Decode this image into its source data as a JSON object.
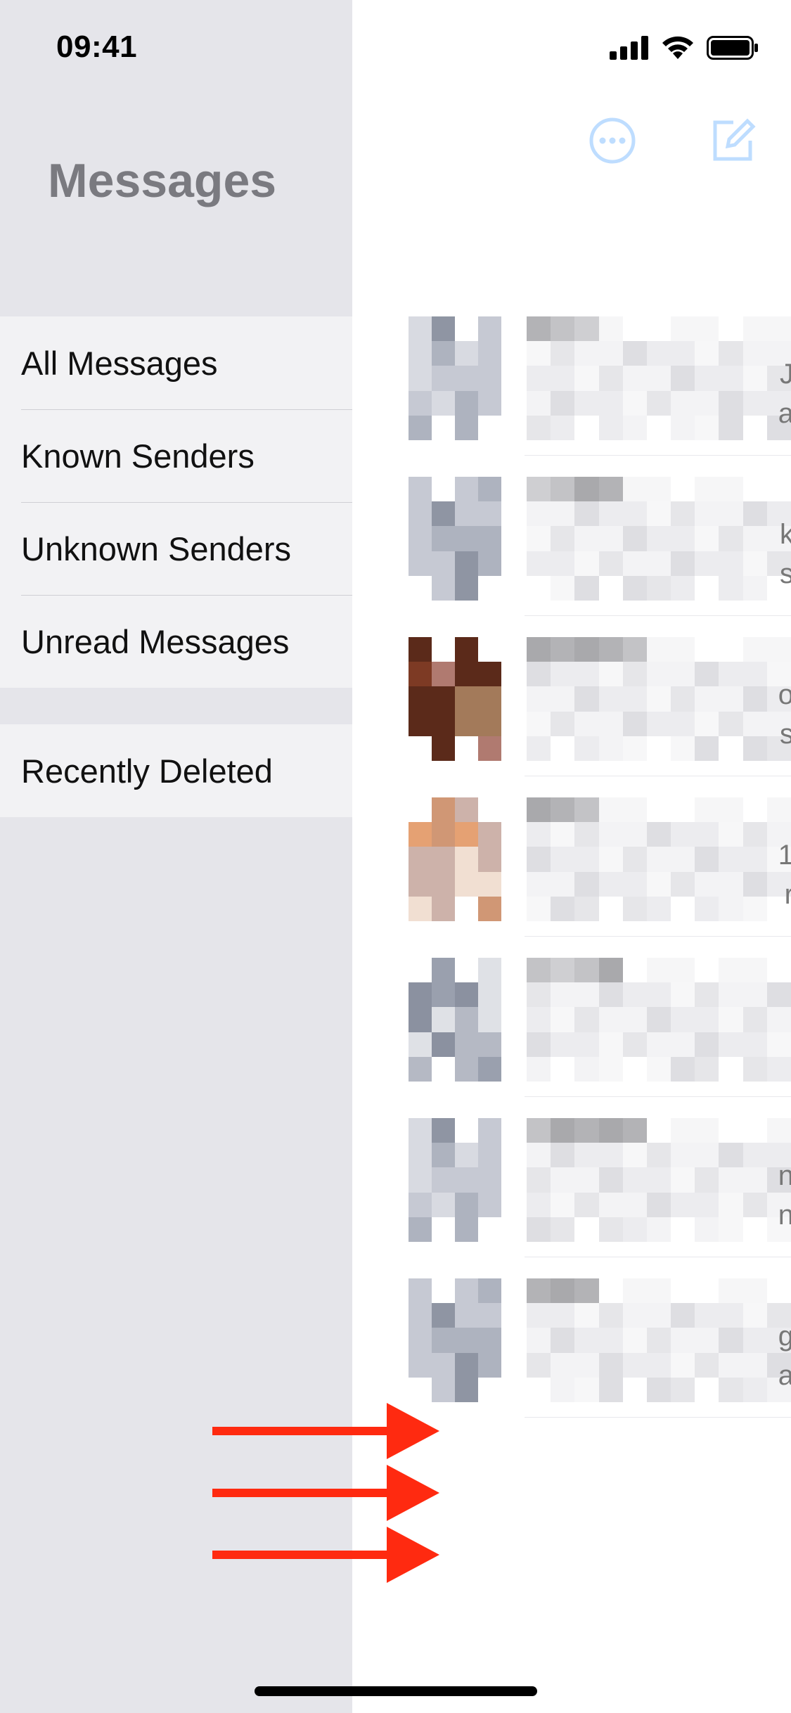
{
  "status_bar": {
    "time": "09:41"
  },
  "sidebar": {
    "title": "Messages",
    "filters": [
      {
        "label": "All Messages"
      },
      {
        "label": "Known Senders"
      },
      {
        "label": "Unknown Senders"
      },
      {
        "label": "Unread Messages"
      }
    ],
    "secondary": [
      {
        "label": "Recently Deleted"
      }
    ]
  },
  "toolbar": {
    "more_icon": "ellipsis-circle-icon",
    "compose_icon": "compose-icon"
  },
  "conversations": [
    {
      "avatar_palette": [
        "#d8dae1",
        "#c6c9d3",
        "#aeb3bf",
        "#8f95a3"
      ],
      "edge_chars": [
        "J",
        "a"
      ]
    },
    {
      "avatar_palette": [
        "#d8dae1",
        "#c6c9d3",
        "#aeb3bf",
        "#8f95a3"
      ],
      "edge_chars": [
        "k",
        "s"
      ]
    },
    {
      "avatar_palette": [
        "#b07a70",
        "#7d3a24",
        "#5b2a1a",
        "#a37a5a"
      ],
      "edge_chars": [
        "o",
        "s"
      ]
    },
    {
      "avatar_palette": [
        "#f1dfd2",
        "#d09775",
        "#e5a173",
        "#cdb2aa"
      ],
      "edge_chars": [
        "1",
        "r"
      ]
    },
    {
      "avatar_palette": [
        "#dfe1e6",
        "#b5b9c4",
        "#9aa0ae",
        "#8b91a0"
      ],
      "edge_chars": [
        "",
        ""
      ]
    },
    {
      "avatar_palette": [
        "#d8dae1",
        "#c6c9d3",
        "#aeb3bf",
        "#8f95a3"
      ],
      "edge_chars": [
        "n",
        "n"
      ]
    },
    {
      "avatar_palette": [
        "#d8dae1",
        "#c6c9d3",
        "#aeb3bf",
        "#8f95a3"
      ],
      "edge_chars": [
        "g",
        "a"
      ]
    }
  ],
  "annotation": {
    "arrow_color": "#ff2a10",
    "arrow_count": 3
  },
  "colors": {
    "sidebar_bg": "#e5e5ea",
    "group_bg": "#f2f2f4",
    "title_gray": "#7a7a80",
    "icon_blue": "#007aff"
  }
}
